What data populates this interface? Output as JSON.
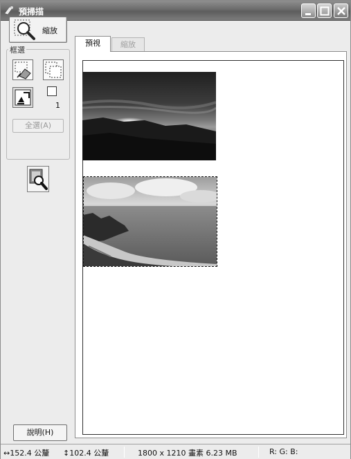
{
  "window": {
    "title": "預掃描"
  },
  "left_panel": {
    "zoom_button_label": "縮放",
    "marquee_group_title": "框選",
    "marquee_count": "1",
    "select_all_label": "全選(A)",
    "help_button_label": "說明(H)"
  },
  "tabs": [
    {
      "label": "預視",
      "active": true
    },
    {
      "label": "縮放",
      "active": false
    }
  ],
  "status": {
    "width": "↔152.4 公釐",
    "height": "↕102.4 公釐",
    "image_info": "1800 x 1210 畫素 6.23 MB",
    "rgb": "R: G: B:"
  },
  "colors": {
    "titlebar": "#6b6b6b",
    "window_bg": "#ececec",
    "preview_bg": "#ffffff"
  },
  "icons": {
    "app": "scanner-icon",
    "zoom": "magnifier-icon",
    "marquee_erase": "eraser-icon",
    "marquee_create": "marquee-icon",
    "auto_locate": "auto-locate-icon",
    "auto_exposure": "auto-exposure-icon"
  }
}
